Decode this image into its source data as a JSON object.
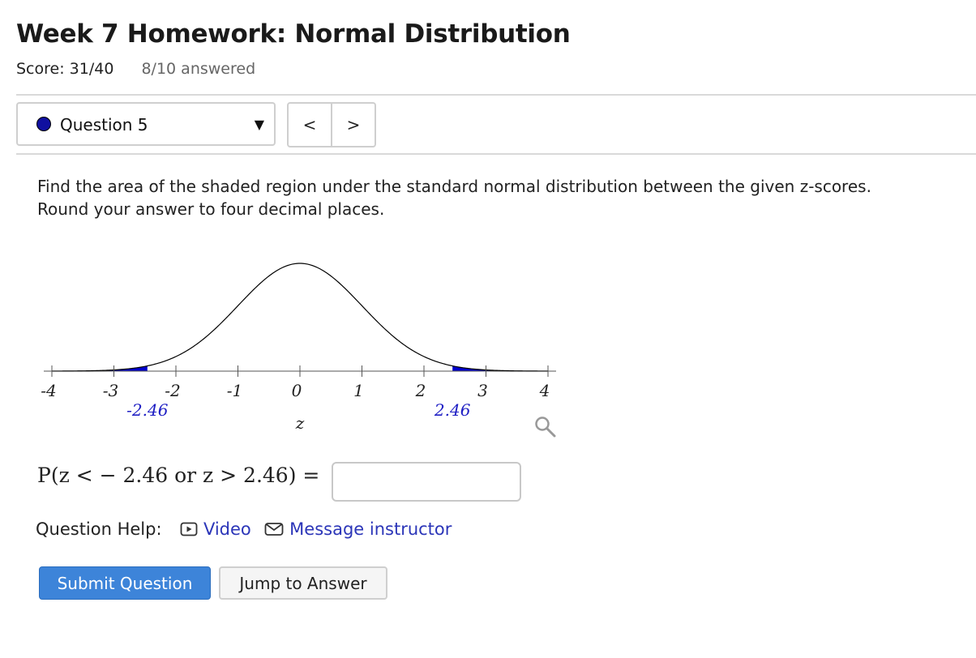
{
  "header": {
    "title": "Week 7 Homework: Normal Distribution",
    "score": "Score: 31/40",
    "answered": "8/10 answered"
  },
  "question_nav": {
    "selected": "Question 5",
    "prev_label": "<",
    "next_label": ">"
  },
  "question": {
    "prompt_line1": "Find the area of the shaded region under the standard normal distribution between the given z-scores.",
    "prompt_line2": "Round your answer to four decimal places."
  },
  "chart_data": {
    "type": "area",
    "distribution": "standard normal",
    "xlabel": "z",
    "xlim": [
      -4,
      4
    ],
    "ticks": [
      {
        "value": -4,
        "label": "-4"
      },
      {
        "value": -3,
        "label": "-3"
      },
      {
        "value": -2,
        "label": "-2"
      },
      {
        "value": -1,
        "label": "-1"
      },
      {
        "value": 0,
        "label": "0"
      },
      {
        "value": 1,
        "label": "1"
      },
      {
        "value": 2,
        "label": "2"
      },
      {
        "value": 3,
        "label": "3"
      },
      {
        "value": 4,
        "label": "4"
      }
    ],
    "shaded_regions": [
      {
        "from": -4,
        "to": -2.46
      },
      {
        "from": 2.46,
        "to": 4
      }
    ],
    "marked_values": [
      {
        "value": -2.46,
        "label": "-2.46"
      },
      {
        "value": 2.46,
        "label": "2.46"
      }
    ],
    "curve_color": "#000000",
    "shade_color": "#0000cc",
    "marker_label_color": "#1f1fc4"
  },
  "answer": {
    "formula_prefix": "P(z <  − 2.46  or  z > 2.46)  =",
    "value": ""
  },
  "help": {
    "label": "Question Help:",
    "video": "Video",
    "message": "Message instructor"
  },
  "actions": {
    "submit": "Submit Question",
    "jump": "Jump to Answer"
  }
}
